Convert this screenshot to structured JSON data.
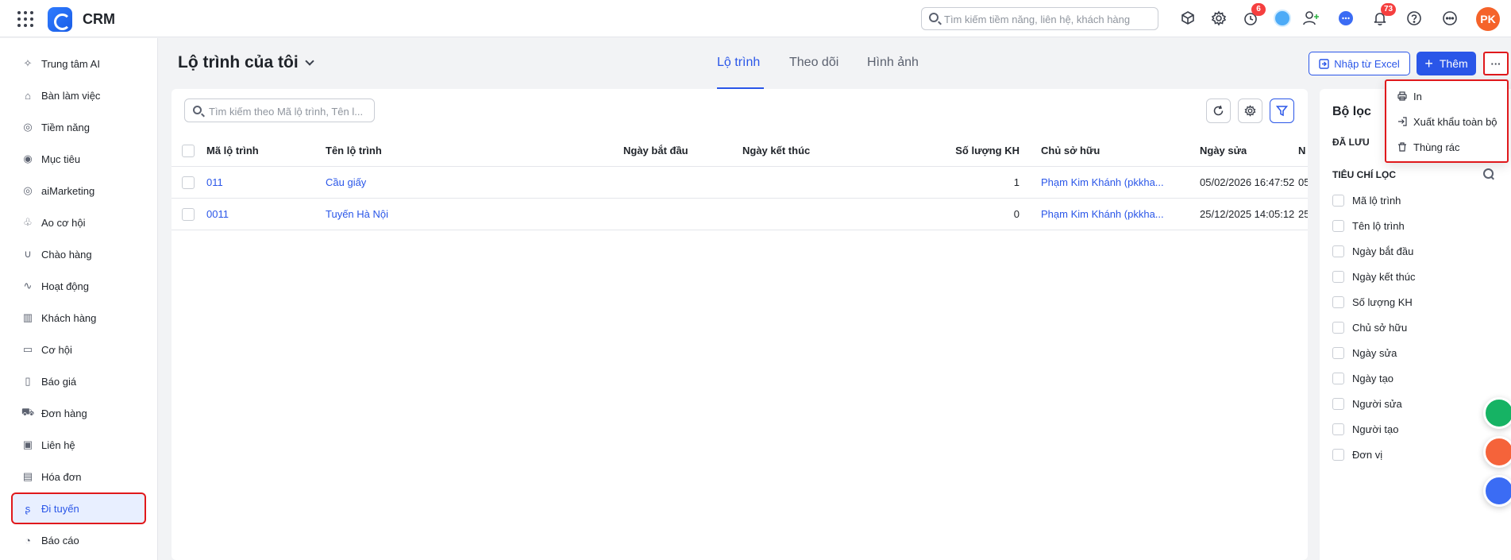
{
  "app": {
    "title": "CRM"
  },
  "topbar": {
    "search_placeholder": "Tìm kiếm tiềm năng, liên hệ, khách hàng",
    "timer_badge": "6",
    "notification_badge": "73",
    "user_initials": "PK"
  },
  "sidebar": {
    "items": [
      {
        "label": "Trung tâm AI",
        "icon": "sparkle-icon"
      },
      {
        "label": "Bàn làm việc",
        "icon": "home-icon"
      },
      {
        "label": "Tiềm năng",
        "icon": "lead-icon"
      },
      {
        "label": "Mục tiêu",
        "icon": "target-icon"
      },
      {
        "label": "aiMarketing",
        "icon": "marketing-icon"
      },
      {
        "label": "Ao cơ hội",
        "icon": "pool-icon"
      },
      {
        "label": "Chào hàng",
        "icon": "magnet-icon"
      },
      {
        "label": "Hoạt động",
        "icon": "activity-icon"
      },
      {
        "label": "Khách hàng",
        "icon": "building-icon"
      },
      {
        "label": "Cơ hội",
        "icon": "wallet-icon"
      },
      {
        "label": "Báo giá",
        "icon": "quote-icon"
      },
      {
        "label": "Đơn hàng",
        "icon": "cart-icon"
      },
      {
        "label": "Liên hệ",
        "icon": "contact-icon"
      },
      {
        "label": "Hóa đơn",
        "icon": "invoice-icon"
      },
      {
        "label": "Đi tuyến",
        "icon": "route-icon",
        "active": true
      },
      {
        "label": "Báo cáo",
        "icon": "report-icon"
      }
    ]
  },
  "header": {
    "title": "Lộ trình của tôi",
    "tabs": [
      {
        "label": "Lộ trình",
        "active": true
      },
      {
        "label": "Theo dõi"
      },
      {
        "label": "Hình ảnh"
      }
    ],
    "import_label": "Nhập từ Excel",
    "add_label": "Thêm",
    "more_label": "···"
  },
  "menu": {
    "items": [
      {
        "label": "In",
        "icon": "printer-icon"
      },
      {
        "label": "Xuất khẩu toàn bộ",
        "icon": "export-icon"
      },
      {
        "label": "Thùng rác",
        "icon": "trash-icon"
      }
    ]
  },
  "list": {
    "search_placeholder": "Tìm kiếm theo Mã lộ trình, Tên l...",
    "columns": [
      "Mã lộ trình",
      "Tên lộ trình",
      "Ngày bắt đầu",
      "Ngày kết thúc",
      "Số lượng KH",
      "Chủ sở hữu",
      "Ngày sửa",
      "N"
    ],
    "rows": [
      {
        "code": "011",
        "name": "Cầu giấy",
        "start": "",
        "end": "",
        "count": "1",
        "owner": "Phạm Kim Khánh (pkkha...",
        "modified": "05/02/2026 16:47:52",
        "extra": "05"
      },
      {
        "code": "0011",
        "name": "Tuyến Hà Nội",
        "start": "",
        "end": "",
        "count": "0",
        "owner": "Phạm Kim Khánh (pkkha...",
        "modified": "25/12/2025 14:05:12",
        "extra": "25"
      }
    ]
  },
  "filter": {
    "title": "Bộ lọc",
    "saved_label": "ĐÃ LƯU",
    "criteria_label": "TIÊU CHÍ LỌC",
    "criteria": [
      "Mã lộ trình",
      "Tên lộ trình",
      "Ngày bắt đầu",
      "Ngày kết thúc",
      "Số lượng KH",
      "Chủ sở hữu",
      "Ngày sửa",
      "Ngày tạo",
      "Người sửa",
      "Người tạo",
      "Đơn vị"
    ]
  },
  "colors": {
    "accent": "#2a56e8",
    "highlight": "#e0191c",
    "avatar": "#f5632a",
    "badge": "#f53f3f"
  }
}
